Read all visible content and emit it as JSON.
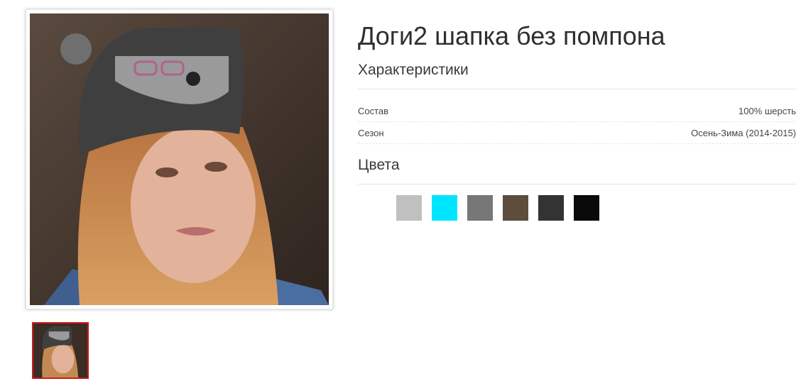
{
  "product": {
    "title": "Доги2 шапка без помпона",
    "image_alt": "Доги2 шапка без помпона"
  },
  "characteristics": {
    "heading": "Характеристики",
    "rows": [
      {
        "label": "Состав",
        "value": "100% шерсть"
      },
      {
        "label": "Сезон",
        "value": "Осень-Зима (2014-2015)"
      }
    ]
  },
  "colors": {
    "heading": "Цвета",
    "swatches": [
      "#ffffff",
      "#c0c0c0",
      "#00e5ff",
      "#777777",
      "#5e4c3c",
      "#333333",
      "#0a0a0a"
    ]
  }
}
